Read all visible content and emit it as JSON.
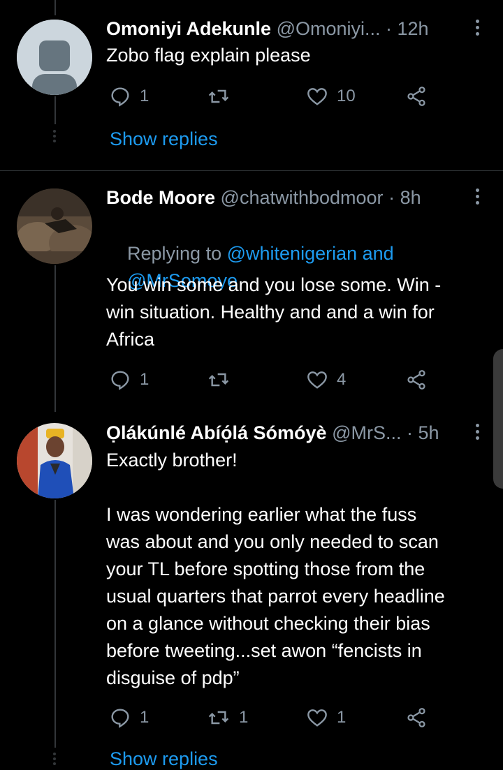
{
  "tweets": [
    {
      "name": "Omoniyi Adekunle",
      "handle": "@Omoniyi...",
      "time": "· 12h",
      "text": "Zobo flag explain please",
      "replies": "1",
      "retweets": "",
      "likes": "10",
      "show_replies": "Show replies",
      "avatar": "default-avatar"
    },
    {
      "name": "Bode Moore",
      "handle": "@chatwithbodmoor",
      "time": "· 8h",
      "replying_prefix": "Replying to ",
      "replying_line1": "@whitenigerian and",
      "replying_line2": "@MrSomoye",
      "text": "You win some and you lose some. Win -\nwin situation. Healthy and and a win for\nAfrica",
      "replies": "1",
      "retweets": "",
      "likes": "4",
      "avatar": "photo-avatar"
    },
    {
      "name": "Ọlákúnlé Abíọ́lá Sómóyè",
      "handle": "@MrS...",
      "time": "· 5h",
      "text": "Exactly brother!\n\nI was wondering earlier what the fuss\nwas about and you only needed to scan\nyour TL before spotting those from the\nusual quarters that parrot every headline\non a glance without checking their bias\nbefore tweeting...set awon “fencists in\ndisguise of pdp”",
      "replies": "1",
      "retweets": "1",
      "likes": "1",
      "show_replies": "Show replies",
      "avatar": "photo-avatar"
    }
  ],
  "colors": {
    "background": "#000000",
    "secondary_text": "#8b98a5",
    "link": "#1d9bf0",
    "divider": "#2f3336"
  }
}
